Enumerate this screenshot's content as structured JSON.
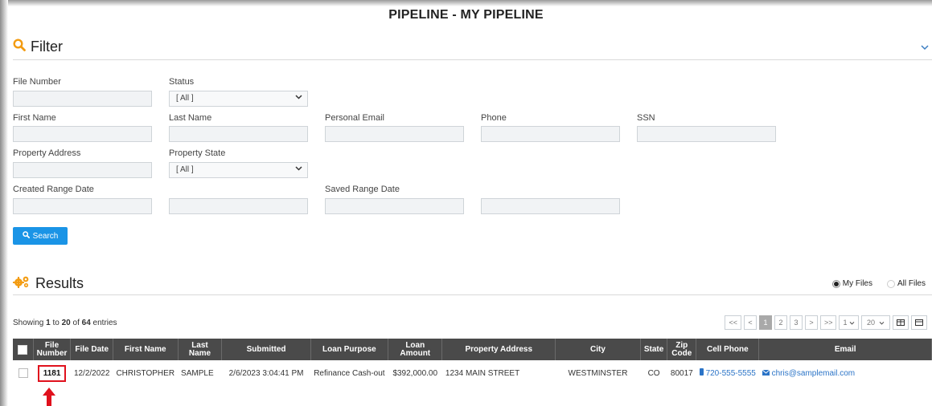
{
  "page_title": "PIPELINE - MY PIPELINE",
  "filter": {
    "heading": "Filter",
    "icon": "search-icon",
    "fields": {
      "file_number": {
        "label": "File Number",
        "value": ""
      },
      "status": {
        "label": "Status",
        "value": "[ All ]"
      },
      "first_name": {
        "label": "First Name",
        "value": ""
      },
      "last_name": {
        "label": "Last Name",
        "value": ""
      },
      "personal_email": {
        "label": "Personal Email",
        "value": ""
      },
      "phone": {
        "label": "Phone",
        "value": ""
      },
      "ssn": {
        "label": "SSN",
        "value": ""
      },
      "property_address": {
        "label": "Property Address",
        "value": ""
      },
      "property_state": {
        "label": "Property State",
        "value": "[ All ]"
      },
      "created_range_date": {
        "label": "Created Range Date",
        "from": "",
        "to": ""
      },
      "saved_range_date": {
        "label": "Saved Range Date",
        "from": "",
        "to": ""
      }
    },
    "search_button": "Search"
  },
  "results": {
    "heading": "Results",
    "icon": "gears-icon",
    "radio_my_files": "My Files",
    "radio_all_files": "All Files",
    "selected_radio": "My Files",
    "showing": {
      "prefix": "Showing ",
      "from": "1",
      "mid1": " to ",
      "to": "20",
      "mid2": " of ",
      "total": "64",
      "suffix": " entries"
    },
    "pager": {
      "first": "<<",
      "prev": "<",
      "pages": [
        "1",
        "2",
        "3"
      ],
      "active_page": "1",
      "next": ">",
      "last": ">>",
      "page_select": "1",
      "page_size": "20"
    },
    "columns": [
      "File Number",
      "File Date",
      "First Name",
      "Last Name",
      "Submitted",
      "Loan Purpose",
      "Loan Amount",
      "Property Address",
      "City",
      "State",
      "Zip Code",
      "Cell Phone",
      "Email"
    ],
    "rows": [
      {
        "file_number": "1181",
        "file_date": "12/2/2022",
        "first_name": "CHRISTOPHER",
        "last_name": "SAMPLE",
        "submitted": "2/6/2023 3:04:41 PM",
        "loan_purpose": "Refinance Cash-out",
        "loan_amount": "$392,000.00",
        "property_address": "1234 MAIN STREET",
        "city": "WESTMINSTER",
        "state": "CO",
        "zip": "80017",
        "cell_phone": "720-555-5555",
        "email": "chris@samplemail.com"
      }
    ]
  },
  "colors": {
    "accent_orange": "#f39c12",
    "primary_blue": "#1a94e6",
    "header_dark": "#4a4a4a",
    "annotation_red": "#e0111d"
  }
}
